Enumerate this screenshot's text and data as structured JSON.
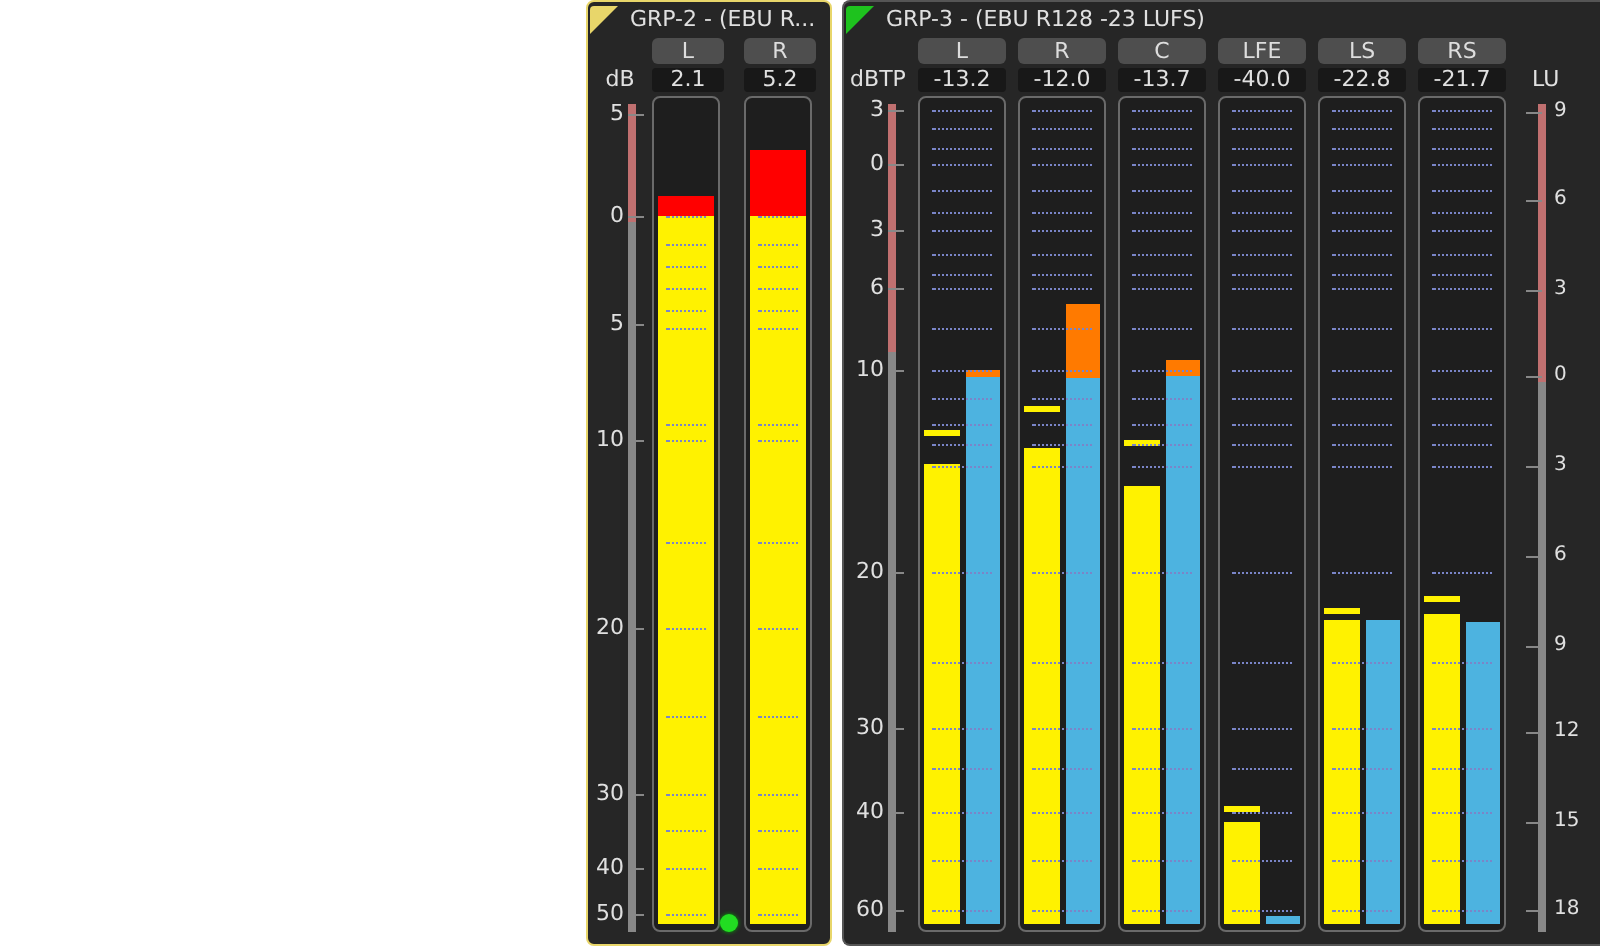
{
  "groups": [
    {
      "title": "GRP-2 - (EBU R...",
      "color": "#e8d66a",
      "selected": true,
      "scale_left": {
        "unit": "dB",
        "ticks": [
          "5",
          "0",
          "5",
          "10",
          "20",
          "30",
          "40",
          "50"
        ]
      },
      "status": {
        "on": true
      },
      "channels": [
        {
          "name": "L",
          "reading": "2.1",
          "bars": [
            {
              "kind": "sample",
              "level": 0.888
            }
          ]
        },
        {
          "name": "R",
          "reading": "5.2",
          "bars": [
            {
              "kind": "sample",
              "level": 0.944
            }
          ]
        }
      ]
    },
    {
      "title": "GRP-3 - (EBU R128 -23 LUFS)",
      "color": "#1ec21e",
      "selected": false,
      "scale_left": {
        "unit": "dBTP",
        "ticks": [
          "3",
          "0",
          "3",
          "6",
          "10",
          "20",
          "30",
          "40",
          "60"
        ]
      },
      "scale_right": {
        "unit": "LU",
        "ticks": [
          "9",
          "6",
          "3",
          "0",
          "3",
          "6",
          "9",
          "12",
          "15",
          "18"
        ]
      },
      "channels": [
        {
          "name": "L",
          "reading": "-13.2",
          "bars": [
            {
              "kind": "peak",
              "level": 0.56,
              "hold": {
                "level": 0.595
              }
            },
            {
              "kind": "loudness",
              "level": 0.675
            }
          ]
        },
        {
          "name": "R",
          "reading": "-12.0",
          "bars": [
            {
              "kind": "peak",
              "level": 0.58,
              "hold": {
                "level": 0.624
              }
            },
            {
              "kind": "loudness",
              "level": 0.757
            }
          ]
        },
        {
          "name": "C",
          "reading": "-13.7",
          "bars": [
            {
              "kind": "peak",
              "level": 0.534,
              "hold": {
                "level": 0.583
              }
            },
            {
              "kind": "loudness",
              "level": 0.687
            }
          ]
        },
        {
          "name": "LFE",
          "reading": "-40.0",
          "bars": [
            {
              "kind": "peak",
              "level": 0.124,
              "hold": {
                "level": 0.136
              }
            },
            {
              "kind": "loudness",
              "level": 0.01
            }
          ]
        },
        {
          "name": "LS",
          "reading": "-22.8",
          "bars": [
            {
              "kind": "peak",
              "level": 0.371,
              "hold": {
                "level": 0.377
              }
            },
            {
              "kind": "loudness",
              "level": 0.371
            }
          ]
        },
        {
          "name": "RS",
          "reading": "-21.7",
          "bars": [
            {
              "kind": "peak",
              "level": 0.379,
              "hold": {
                "level": 0.393
              }
            },
            {
              "kind": "loudness",
              "level": 0.369
            }
          ]
        }
      ]
    }
  ]
}
